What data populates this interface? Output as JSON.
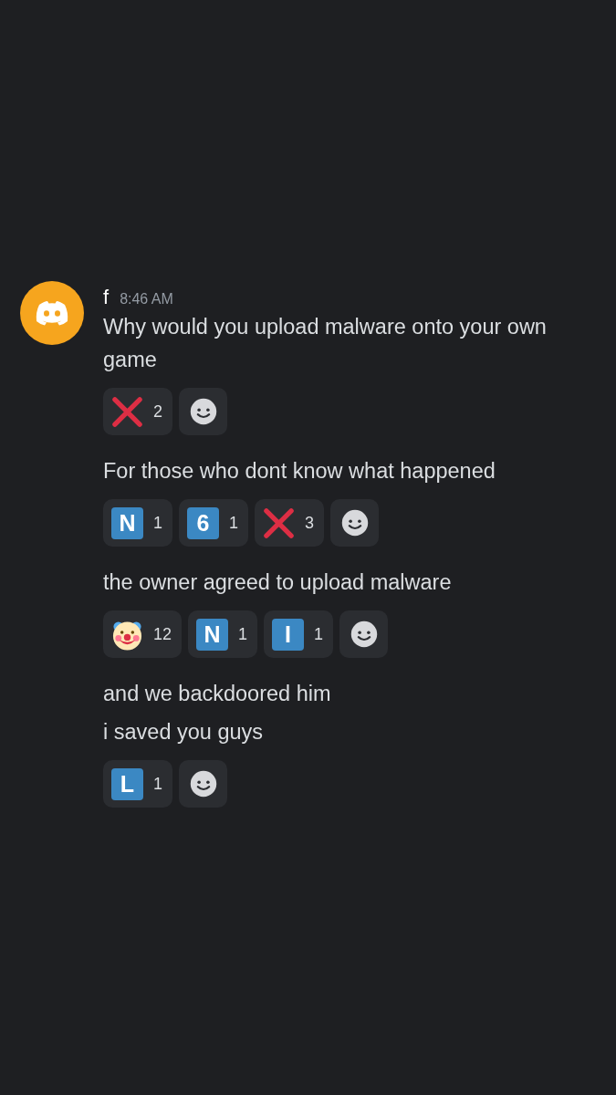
{
  "author": {
    "name": "f",
    "timestamp": "8:46 AM"
  },
  "messages": [
    {
      "text": "Why would you upload malware onto your own game",
      "reactions": [
        {
          "kind": "cross",
          "count": "2"
        },
        {
          "kind": "add"
        }
      ]
    },
    {
      "text": "For those who dont know what happened",
      "reactions": [
        {
          "kind": "letter",
          "letter": "N",
          "count": "1"
        },
        {
          "kind": "letter",
          "letter": "6",
          "count": "1"
        },
        {
          "kind": "cross",
          "count": "3"
        },
        {
          "kind": "add"
        }
      ]
    },
    {
      "text": "the owner agreed to upload malware",
      "reactions": [
        {
          "kind": "clown",
          "count": "12"
        },
        {
          "kind": "letter",
          "letter": "N",
          "count": "1"
        },
        {
          "kind": "letter",
          "letter": "I",
          "count": "1"
        },
        {
          "kind": "add"
        }
      ]
    },
    {
      "text": "and we backdoored him"
    },
    {
      "text": "i saved you guys",
      "reactions": [
        {
          "kind": "letter",
          "letter": "L",
          "count": "1"
        },
        {
          "kind": "add"
        }
      ]
    }
  ]
}
